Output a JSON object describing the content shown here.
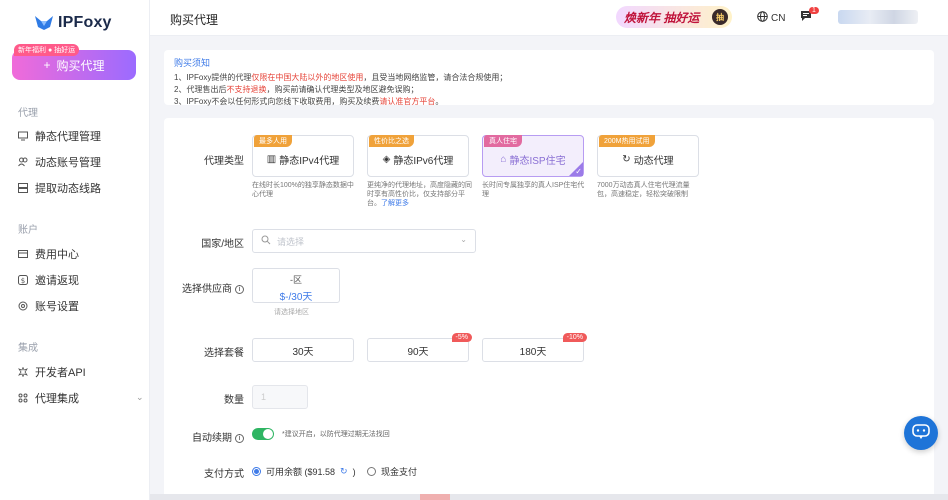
{
  "app": {
    "logo_text": "IPFoxy"
  },
  "sidebar": {
    "promo_tag": "新年福利 ● 抽好运",
    "buy_label": "购买代理",
    "groups": [
      {
        "title": "代理",
        "items": [
          {
            "label": "静态代理管理",
            "icon": "monitor-icon"
          },
          {
            "label": "动态账号管理",
            "icon": "users-icon"
          },
          {
            "label": "提取动态线路",
            "icon": "server-icon"
          }
        ]
      },
      {
        "title": "账户",
        "items": [
          {
            "label": "费用中心",
            "icon": "wallet-icon"
          },
          {
            "label": "邀请返现",
            "icon": "dollar-icon"
          },
          {
            "label": "账号设置",
            "icon": "settings-icon"
          }
        ]
      },
      {
        "title": "集成",
        "items": [
          {
            "label": "开发者API",
            "icon": "api-icon"
          },
          {
            "label": "代理集成",
            "icon": "puzzle-icon"
          }
        ]
      }
    ]
  },
  "topbar": {
    "title": "购买代理",
    "banner_text": "焕新年 抽好运",
    "banner_btn": "抽",
    "lang": "CN",
    "msg_count": "1"
  },
  "notice": {
    "title": "购买须知",
    "lines": [
      [
        "1、IPFoxy提供的代理",
        "仅限在中国大陆以外的地区使用",
        "，且受当地网络监管，请合法合规使用；"
      ],
      [
        "2、代理售出后",
        "不支持退换",
        "，购买前请确认代理类型及地区避免误购；"
      ],
      [
        "3、IPFoxy不会以任何形式向您线下收取费用，购买及续费",
        "请认准官方平台",
        "。"
      ]
    ]
  },
  "form": {
    "proxy_type_label": "代理类型",
    "types": [
      {
        "tag": "最多人用",
        "name": "静态IPv4代理",
        "desc": "在线时长100%的独享静态数据中心代理",
        "link": "",
        "selected": false
      },
      {
        "tag": "性价比之选",
        "name": "静态IPv6代理",
        "desc": "更纯净的代理地址，高度隐藏的同时享有高性价比，仅支持部分平台。",
        "link": "了解更多",
        "selected": false
      },
      {
        "tag": "真人住宅",
        "name": "静态ISP住宅",
        "desc": "长时间专属独享的真人ISP住宅代理",
        "link": "",
        "selected": true
      },
      {
        "tag": "200M热用试用",
        "name": "动态代理",
        "desc": "7000万动态真人住宅代理流量包，高速稳定，轻松突破限制",
        "link": "",
        "selected": false
      }
    ],
    "country_label": "国家/地区",
    "country_placeholder": "请选择",
    "supplier_label": "选择供应商",
    "supplier_top": "-区",
    "supplier_price": "$-/30天",
    "supplier_hint": "请选择地区",
    "plan_label": "选择套餐",
    "plans": [
      {
        "label": "30天",
        "discount": ""
      },
      {
        "label": "90天",
        "discount": "-5%"
      },
      {
        "label": "180天",
        "discount": "-10%"
      }
    ],
    "qty_label": "数量",
    "qty_value": "1",
    "renew_label": "自动续期",
    "renew_on": true,
    "renew_hint": "*建议开启，以防代理过期无法找回",
    "pay_label": "支付方式",
    "pay_balance": "可用余额 ($91.58",
    "pay_cash": "现金支付"
  },
  "colors": {
    "accent": "#3f7be8",
    "toggle": "#2fb563",
    "discount": "#f05a5a",
    "chat": "#1e74d8"
  }
}
